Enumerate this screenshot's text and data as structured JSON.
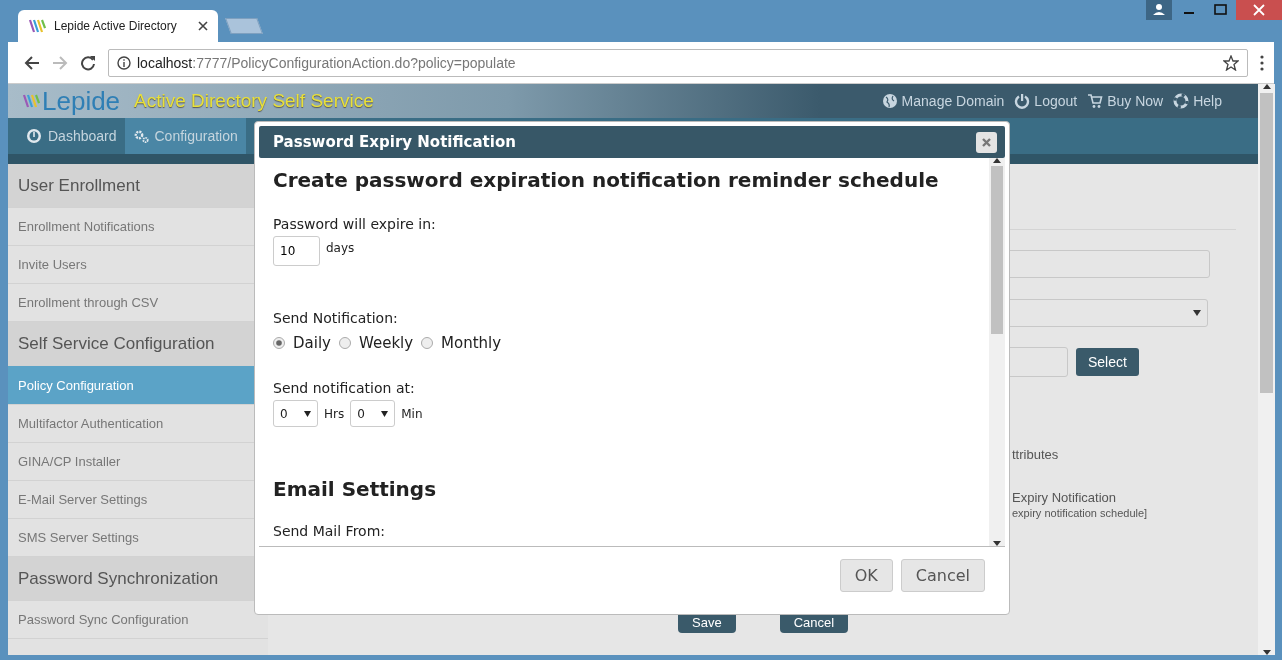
{
  "browser": {
    "tab_title": "Lepide Active Directory",
    "url_host": "localhost",
    "url_path": ":7777/PolicyConfigurationAction.do?policy=populate"
  },
  "app": {
    "logo": "Lepide",
    "product": "Active Directory Self Service",
    "links": [
      {
        "label": "Manage Domain"
      },
      {
        "label": "Logout"
      },
      {
        "label": "Buy Now"
      },
      {
        "label": "Help"
      }
    ]
  },
  "nav": {
    "tabs": [
      {
        "label": "Dashboard",
        "selected": false
      },
      {
        "label": "Configuration",
        "selected": true
      }
    ]
  },
  "sidebar": {
    "items": [
      {
        "label": "User Enrollment",
        "kind": "header",
        "selected": false
      },
      {
        "label": "Enrollment Notifications",
        "kind": "link",
        "selected": false
      },
      {
        "label": "Invite Users",
        "kind": "link",
        "selected": false
      },
      {
        "label": "Enrollment through CSV",
        "kind": "link",
        "selected": false
      },
      {
        "label": "Self Service Configuration",
        "kind": "header",
        "selected": false
      },
      {
        "label": "Policy Configuration",
        "kind": "link",
        "selected": true
      },
      {
        "label": "Multifactor Authentication",
        "kind": "link",
        "selected": false
      },
      {
        "label": "GINA/CP Installer",
        "kind": "link",
        "selected": false
      },
      {
        "label": "E-Mail Server Settings",
        "kind": "link",
        "selected": false
      },
      {
        "label": "SMS Server Settings",
        "kind": "link",
        "selected": false
      },
      {
        "label": "Password Synchronization",
        "kind": "header",
        "selected": false
      },
      {
        "label": "Password Sync Configuration",
        "kind": "link",
        "selected": false
      }
    ]
  },
  "main": {
    "select_button": "Select",
    "attributes_text": "ttributes",
    "notification_title": "Expiry Notification",
    "notification_note": "expiry notification schedule]",
    "buttons": [
      "Save",
      "Cancel"
    ]
  },
  "dialog": {
    "title": "Password Expiry Notification",
    "heading": "Create password expiration notification reminder schedule",
    "expire_label": "Password will expire in:",
    "expire_value": "10",
    "expire_unit": "days",
    "send_label": "Send Notification:",
    "frequencies": [
      {
        "label": "Daily",
        "selected": true
      },
      {
        "label": "Weekly",
        "selected": false
      },
      {
        "label": "Monthly",
        "selected": false
      }
    ],
    "time_label": "Send notification at:",
    "hours": "0",
    "hours_unit": "Hrs",
    "minutes": "0",
    "minutes_unit": "Min",
    "email_heading": "Email Settings",
    "mail_from_label": "Send Mail From:",
    "buttons": [
      "OK",
      "Cancel"
    ]
  }
}
